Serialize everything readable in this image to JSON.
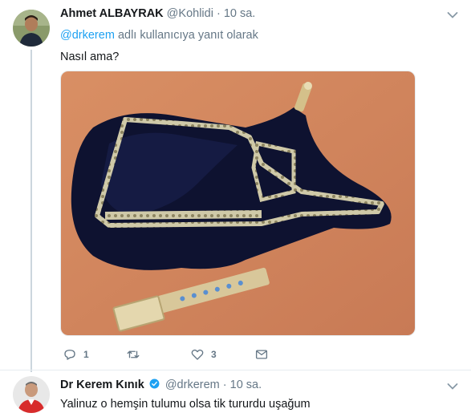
{
  "tweet1": {
    "author_name": "Ahmet ALBAYRAK",
    "author_handle": "@Kohlidi",
    "separator": "·",
    "time": "10 sa.",
    "reply_mention": "@drkerem",
    "reply_suffix": "adlı kullanıcıya yanıt olarak",
    "text": "Nasıl ama?",
    "actions": {
      "reply_count": "1",
      "retweet_count": "",
      "like_count": "3"
    }
  },
  "tweet2": {
    "author_name": "Dr Kerem Kınık",
    "author_handle": "@drkerem",
    "separator": "·",
    "time": "10 sa.",
    "verified": true,
    "text": "Yalinuz o hemşin tulumu olsa tik tururdu uşağum"
  },
  "colors": {
    "accent": "#1da1f2",
    "secondary_text": "#657786",
    "primary_text": "#14171a",
    "thread_line": "#ccd6dd"
  },
  "icons": [
    "reply-icon",
    "retweet-icon",
    "like-icon",
    "direct-message-icon",
    "chevron-down-icon",
    "verified-badge-icon"
  ]
}
